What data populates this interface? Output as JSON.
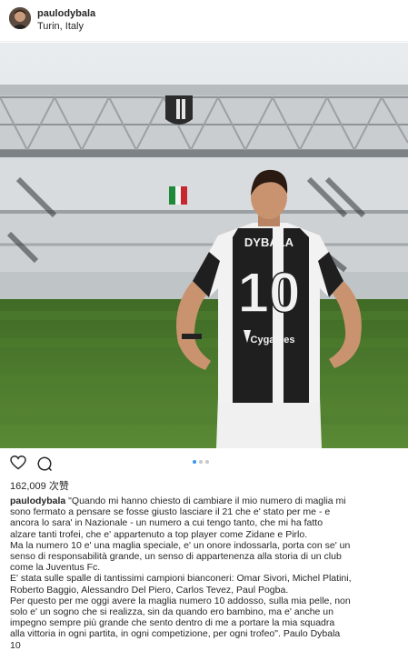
{
  "post": {
    "username": "paulodybala",
    "location": "Turin, Italy",
    "likes": "162,009 次赞",
    "carousel": {
      "count": 3,
      "active": 1
    }
  },
  "photo": {
    "jersey_name": "DYBALA",
    "jersey_number": "10",
    "sponsor": "Cygames",
    "colors": {
      "sky": "#dfe3e6",
      "grass": "#4b7a2b",
      "stand": "#cfd3d6",
      "jersey_black": "#1f1f1f",
      "jersey_white": "#f2f2f2"
    }
  },
  "icons": {
    "like": "heart-icon",
    "comment": "comment-icon"
  },
  "caption": {
    "user": "paulodybala",
    "first_line": " \"Quando mi hanno chiesto di cambiare il mio numero di maglia mi",
    "lines": [
      "sono fermato a pensare se fosse giusto lasciare il 21 che e' stato per me - e",
      "ancora lo sara' in Nazionale - un numero a cui tengo tanto, che mi ha fatto",
      "alzare tanti trofei, che e' appartenuto a top player come Zidane e Pirlo.",
      "Ma la numero 10 e' una maglia speciale, e' un onore indossarla, porta con se' un",
      "senso di responsabilità grande, un senso di appartenenza alla storia di un club",
      "come la Juventus Fc.",
      "E' stata sulle spalle di tantissimi campioni bianconeri: Omar Sivori, Michel Platini,",
      "Roberto Baggio, Alessandro Del Piero, Carlos Tevez, Paul Pogba.",
      "Per questo per me oggi avere la maglia numero 10 addosso, sulla mia pelle, non",
      "solo e' un sogno che si realizza, sin da quando ero bambino, ma e' anche un",
      "impegno sempre più grande che sento dentro di me a portare la mia squadra",
      "alla vittoria in ogni partita, in ogni competizione, per ogni trofeo\". Paulo Dybala",
      "10"
    ]
  }
}
